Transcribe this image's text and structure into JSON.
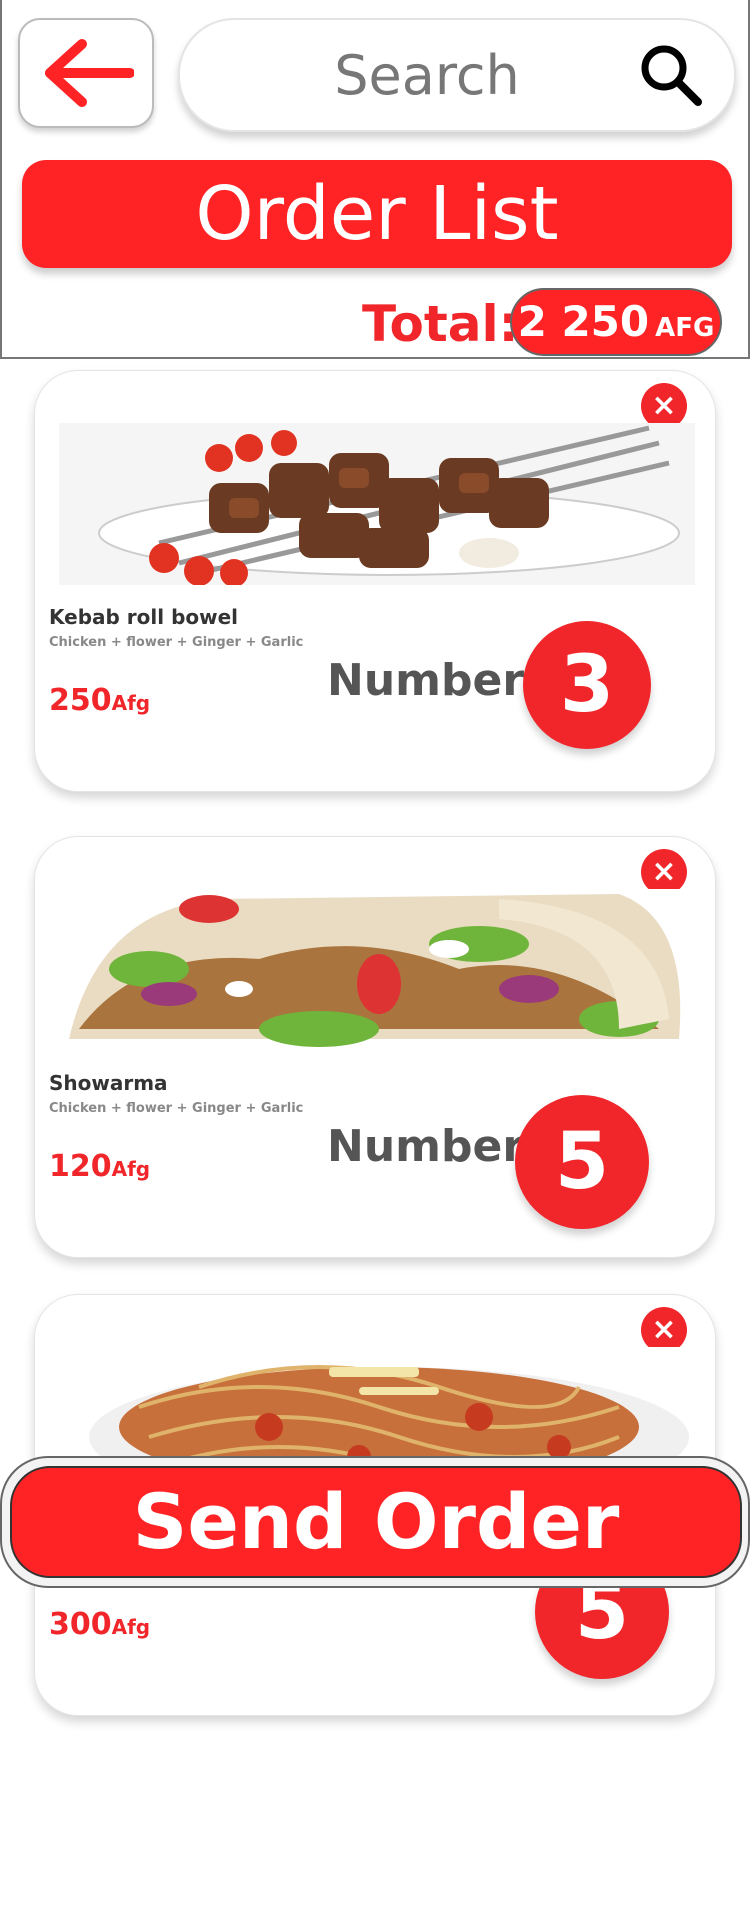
{
  "header": {
    "search_placeholder": "Search",
    "title": "Order List",
    "total_label": "Total:",
    "total_amount": "2 250",
    "total_currency": "AFG"
  },
  "items": [
    {
      "name": "Kebab roll bowel",
      "ingredients": "Chicken + flower + Ginger + Garlic",
      "price": "250",
      "currency": "Afg",
      "number_label": "Number:",
      "number": "3",
      "close": "×"
    },
    {
      "name": "Showarma",
      "ingredients": "Chicken + flower + Ginger + Garlic",
      "price": "120",
      "currency": "Afg",
      "number_label": "Number:",
      "number": "5",
      "close": "×"
    },
    {
      "name": "",
      "ingredients": "",
      "price": "300",
      "currency": "Afg",
      "number_label": "",
      "number": "5",
      "close": "×"
    }
  ],
  "actions": {
    "send_order": "Send Order"
  },
  "colors": {
    "accent": "#ff2325",
    "text_dark": "#333333",
    "muted": "#888888"
  }
}
